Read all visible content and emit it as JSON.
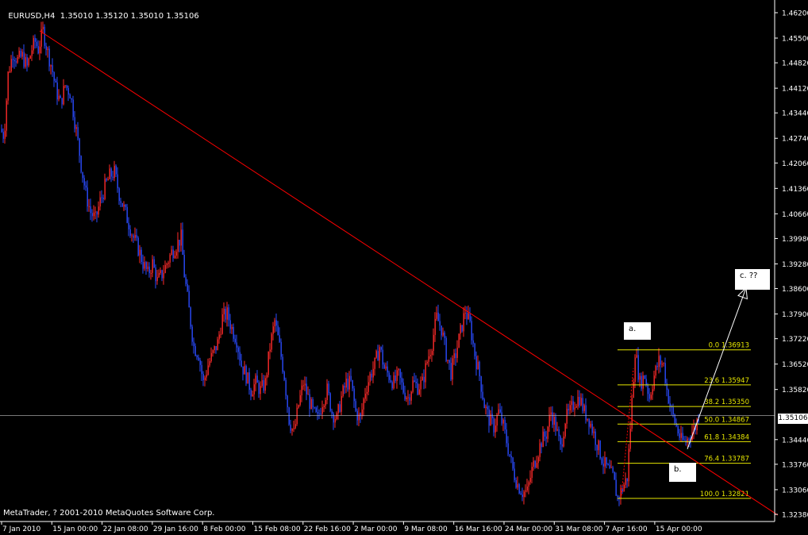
{
  "header": {
    "symbol": "EURUSD,H4",
    "ohlc": "1.35010 1.35120 1.35010 1.35106"
  },
  "copyright": "MetaTrader, ? 2001-2010 MetaQuotes Software Corp.",
  "current_price_tag": "1.35106",
  "annotations": {
    "a": "a.",
    "b": "b.",
    "c": "c.  ??"
  },
  "colors": {
    "background": "#000000",
    "bull_candle": "#ff2a2a",
    "bear_candle": "#2a4bff",
    "trendline": "#ff0000",
    "fib": "#e6e600",
    "axis": "#ffffff",
    "price_line": "#c0c0c0"
  },
  "chart_data": {
    "type": "candlestick",
    "title": "EURUSD,H4",
    "ylim": [
      1.3234,
      1.4626
    ],
    "y_ticks": [
      "1.46200",
      "1.45500",
      "1.44820",
      "1.44120",
      "1.43440",
      "1.42740",
      "1.42060",
      "1.41360",
      "1.40660",
      "1.39980",
      "1.39280",
      "1.38600",
      "1.37900",
      "1.37220",
      "1.36520",
      "1.35820",
      "1.35106",
      "1.34440",
      "1.33760",
      "1.33060",
      "1.32380"
    ],
    "x_ticks": [
      "7 Jan 2010",
      "15 Jan 00:00",
      "22 Jan 08:00",
      "29 Jan 16:00",
      "8 Feb 00:00",
      "15 Feb 08:00",
      "22 Feb 16:00",
      "2 Mar 00:00",
      "9 Mar 08:00",
      "16 Mar 16:00",
      "24 Mar 00:00",
      "31 Mar 08:00",
      "7 Apr 16:00",
      "15 Apr 00:00"
    ],
    "price_path": [
      [
        0,
        1.43
      ],
      [
        5,
        1.428
      ],
      [
        10,
        1.445
      ],
      [
        16,
        1.451
      ],
      [
        22,
        1.449
      ],
      [
        28,
        1.45
      ],
      [
        34,
        1.447
      ],
      [
        40,
        1.452
      ],
      [
        44,
        1.454
      ],
      [
        48,
        1.452
      ],
      [
        54,
        1.457
      ],
      [
        60,
        1.451
      ],
      [
        65,
        1.447
      ],
      [
        70,
        1.441
      ],
      [
        76,
        1.437
      ],
      [
        82,
        1.442
      ],
      [
        88,
        1.44
      ],
      [
        92,
        1.435
      ],
      [
        97,
        1.428
      ],
      [
        102,
        1.42
      ],
      [
        108,
        1.412
      ],
      [
        114,
        1.407
      ],
      [
        120,
        1.405
      ],
      [
        126,
        1.41
      ],
      [
        132,
        1.414
      ],
      [
        138,
        1.417
      ],
      [
        144,
        1.418
      ],
      [
        150,
        1.412
      ],
      [
        156,
        1.408
      ],
      [
        162,
        1.404
      ],
      [
        168,
        1.4
      ],
      [
        174,
        1.397
      ],
      [
        180,
        1.393
      ],
      [
        186,
        1.39
      ],
      [
        192,
        1.393
      ],
      [
        198,
        1.388
      ],
      [
        204,
        1.39
      ],
      [
        210,
        1.393
      ],
      [
        216,
        1.396
      ],
      [
        222,
        1.398
      ],
      [
        228,
        1.4
      ],
      [
        232,
        1.39
      ],
      [
        238,
        1.38
      ],
      [
        244,
        1.37
      ],
      [
        250,
        1.368
      ],
      [
        256,
        1.36
      ],
      [
        262,
        1.365
      ],
      [
        268,
        1.368
      ],
      [
        274,
        1.371
      ],
      [
        280,
        1.378
      ],
      [
        286,
        1.379
      ],
      [
        292,
        1.375
      ],
      [
        298,
        1.372
      ],
      [
        304,
        1.365
      ],
      [
        310,
        1.362
      ],
      [
        316,
        1.358
      ],
      [
        322,
        1.36
      ],
      [
        328,
        1.358
      ],
      [
        334,
        1.36
      ],
      [
        340,
        1.37
      ],
      [
        346,
        1.377
      ],
      [
        352,
        1.37
      ],
      [
        358,
        1.362
      ],
      [
        364,
        1.35
      ],
      [
        370,
        1.346
      ],
      [
        376,
        1.354
      ],
      [
        382,
        1.36
      ],
      [
        388,
        1.356
      ],
      [
        394,
        1.352
      ],
      [
        400,
        1.35
      ],
      [
        406,
        1.355
      ],
      [
        412,
        1.358
      ],
      [
        418,
        1.352
      ],
      [
        424,
        1.35
      ],
      [
        430,
        1.356
      ],
      [
        436,
        1.36
      ],
      [
        442,
        1.36
      ],
      [
        448,
        1.352
      ],
      [
        454,
        1.35
      ],
      [
        460,
        1.358
      ],
      [
        466,
        1.362
      ],
      [
        472,
        1.365
      ],
      [
        478,
        1.37
      ],
      [
        484,
        1.364
      ],
      [
        490,
        1.362
      ],
      [
        496,
        1.36
      ],
      [
        502,
        1.362
      ],
      [
        508,
        1.358
      ],
      [
        514,
        1.356
      ],
      [
        520,
        1.36
      ],
      [
        526,
        1.359
      ],
      [
        532,
        1.36
      ],
      [
        538,
        1.366
      ],
      [
        544,
        1.371
      ],
      [
        550,
        1.378
      ],
      [
        556,
        1.375
      ],
      [
        562,
        1.368
      ],
      [
        568,
        1.363
      ],
      [
        574,
        1.368
      ],
      [
        580,
        1.374
      ],
      [
        586,
        1.38
      ],
      [
        592,
        1.376
      ],
      [
        598,
        1.368
      ],
      [
        604,
        1.362
      ],
      [
        610,
        1.354
      ],
      [
        616,
        1.35
      ],
      [
        622,
        1.348
      ],
      [
        628,
        1.352
      ],
      [
        634,
        1.348
      ],
      [
        640,
        1.342
      ],
      [
        646,
        1.336
      ],
      [
        652,
        1.332
      ],
      [
        658,
        1.33
      ],
      [
        664,
        1.33
      ],
      [
        670,
        1.336
      ],
      [
        676,
        1.34
      ],
      [
        682,
        1.344
      ],
      [
        688,
        1.346
      ],
      [
        694,
        1.352
      ],
      [
        700,
        1.348
      ],
      [
        706,
        1.342
      ],
      [
        712,
        1.35
      ],
      [
        718,
        1.352
      ],
      [
        724,
        1.355
      ],
      [
        730,
        1.356
      ],
      [
        736,
        1.352
      ],
      [
        742,
        1.35
      ],
      [
        748,
        1.346
      ],
      [
        754,
        1.342
      ],
      [
        760,
        1.338
      ],
      [
        766,
        1.336
      ],
      [
        772,
        1.334
      ],
      [
        778,
        1.3282
      ],
      [
        784,
        1.331
      ],
      [
        790,
        1.334
      ],
      [
        796,
        1.355
      ],
      [
        800,
        1.3691
      ],
      [
        806,
        1.36
      ],
      [
        812,
        1.362
      ],
      [
        818,
        1.356
      ],
      [
        824,
        1.362
      ],
      [
        830,
        1.366
      ],
      [
        836,
        1.365
      ],
      [
        840,
        1.358
      ],
      [
        846,
        1.352
      ],
      [
        852,
        1.348
      ],
      [
        858,
        1.344
      ],
      [
        864,
        1.3438
      ],
      [
        870,
        1.346
      ],
      [
        876,
        1.348
      ],
      [
        880,
        1.3511
      ]
    ],
    "trendline": [
      [
        50,
        1.457
      ],
      [
        980,
        1.3236
      ]
    ],
    "arrow": {
      "from": [
        866,
        1.3418
      ],
      "to": [
        940,
        1.3862
      ]
    },
    "dotted_swing": {
      "from": [
        783,
        1.329
      ],
      "to": [
        798,
        1.364
      ]
    },
    "current_price": 1.35106,
    "fibonacci": {
      "x_start": 778,
      "x_end": 946,
      "levels": [
        {
          "label": "0.0",
          "price": 1.36913,
          "text": "1.36913"
        },
        {
          "label": "23.6",
          "price": 1.35947,
          "text": "1.35947"
        },
        {
          "label": "38.2",
          "price": 1.3535,
          "text": "1.35350"
        },
        {
          "label": "50.0",
          "price": 1.34867,
          "text": "1.34867"
        },
        {
          "label": "61.8",
          "price": 1.34384,
          "text": "1.34384"
        },
        {
          "label": "76.4",
          "price": 1.33787,
          "text": "1.33787"
        },
        {
          "label": "100.0",
          "price": 1.32821,
          "text": "1.32821"
        }
      ]
    }
  }
}
